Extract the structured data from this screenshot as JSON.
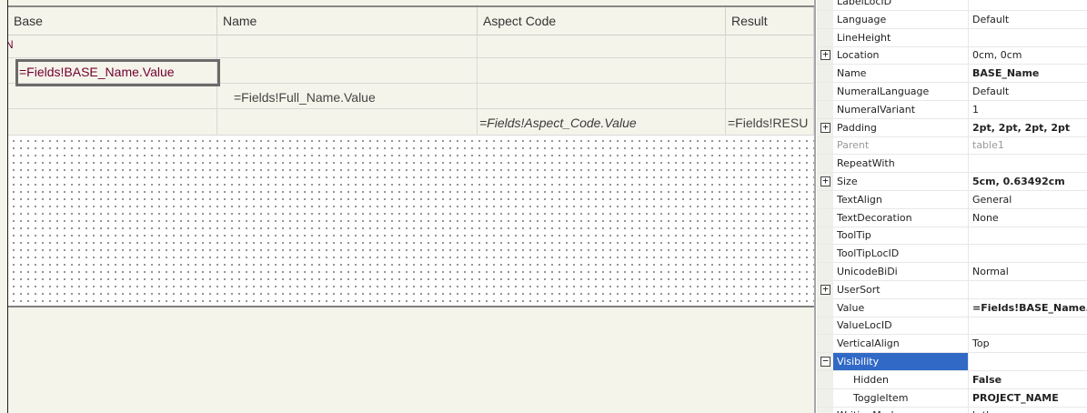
{
  "designer": {
    "columns": [
      "Base",
      "Name",
      "Aspect Code",
      "Result"
    ],
    "group_marker": "N",
    "rows": {
      "base_name": "=Fields!BASE_Name.Value",
      "full_name": "=Fields!Full_Name.Value",
      "aspect_code": "=Fields!Aspect_Code.Value",
      "result": "=Fields!RESU"
    }
  },
  "properties": {
    "rows": [
      {
        "name": "LabelLocID",
        "value": "",
        "expander": "",
        "bold": false,
        "disabled": false,
        "child": false,
        "selected": false
      },
      {
        "name": "Language",
        "value": "Default",
        "expander": "",
        "bold": false,
        "disabled": false,
        "child": false,
        "selected": false
      },
      {
        "name": "LineHeight",
        "value": "",
        "expander": "",
        "bold": false,
        "disabled": false,
        "child": false,
        "selected": false
      },
      {
        "name": "Location",
        "value": "0cm, 0cm",
        "expander": "+",
        "bold": false,
        "disabled": false,
        "child": false,
        "selected": false
      },
      {
        "name": "Name",
        "value": "BASE_Name",
        "expander": "",
        "bold": true,
        "disabled": false,
        "child": false,
        "selected": false
      },
      {
        "name": "NumeralLanguage",
        "value": "Default",
        "expander": "",
        "bold": false,
        "disabled": false,
        "child": false,
        "selected": false
      },
      {
        "name": "NumeralVariant",
        "value": "1",
        "expander": "",
        "bold": false,
        "disabled": false,
        "child": false,
        "selected": false
      },
      {
        "name": "Padding",
        "value": "2pt, 2pt, 2pt, 2pt",
        "expander": "+",
        "bold": true,
        "disabled": false,
        "child": false,
        "selected": false
      },
      {
        "name": "Parent",
        "value": "table1",
        "expander": "",
        "bold": false,
        "disabled": true,
        "child": false,
        "selected": false
      },
      {
        "name": "RepeatWith",
        "value": "",
        "expander": "",
        "bold": false,
        "disabled": false,
        "child": false,
        "selected": false
      },
      {
        "name": "Size",
        "value": "5cm, 0.63492cm",
        "expander": "+",
        "bold": true,
        "disabled": false,
        "child": false,
        "selected": false
      },
      {
        "name": "TextAlign",
        "value": "General",
        "expander": "",
        "bold": false,
        "disabled": false,
        "child": false,
        "selected": false
      },
      {
        "name": "TextDecoration",
        "value": "None",
        "expander": "",
        "bold": false,
        "disabled": false,
        "child": false,
        "selected": false
      },
      {
        "name": "ToolTip",
        "value": "",
        "expander": "",
        "bold": false,
        "disabled": false,
        "child": false,
        "selected": false
      },
      {
        "name": "ToolTipLocID",
        "value": "",
        "expander": "",
        "bold": false,
        "disabled": false,
        "child": false,
        "selected": false
      },
      {
        "name": "UnicodeBiDi",
        "value": "Normal",
        "expander": "",
        "bold": false,
        "disabled": false,
        "child": false,
        "selected": false
      },
      {
        "name": "UserSort",
        "value": "",
        "expander": "+",
        "bold": false,
        "disabled": false,
        "child": false,
        "selected": false
      },
      {
        "name": "Value",
        "value": "=Fields!BASE_Name.Value",
        "expander": "",
        "bold": true,
        "disabled": false,
        "child": false,
        "selected": false
      },
      {
        "name": "ValueLocID",
        "value": "",
        "expander": "",
        "bold": false,
        "disabled": false,
        "child": false,
        "selected": false
      },
      {
        "name": "VerticalAlign",
        "value": "Top",
        "expander": "",
        "bold": false,
        "disabled": false,
        "child": false,
        "selected": false
      },
      {
        "name": "Visibility",
        "value": "",
        "expander": "−",
        "bold": false,
        "disabled": false,
        "child": false,
        "selected": true
      },
      {
        "name": "Hidden",
        "value": "False",
        "expander": "",
        "bold": true,
        "disabled": false,
        "child": true,
        "selected": false
      },
      {
        "name": "ToggleItem",
        "value": "PROJECT_NAME",
        "expander": "",
        "bold": true,
        "disabled": false,
        "child": true,
        "selected": false
      },
      {
        "name": "WritingMode",
        "value": "lr-tb",
        "expander": "",
        "bold": false,
        "disabled": false,
        "child": false,
        "selected": false
      }
    ]
  }
}
